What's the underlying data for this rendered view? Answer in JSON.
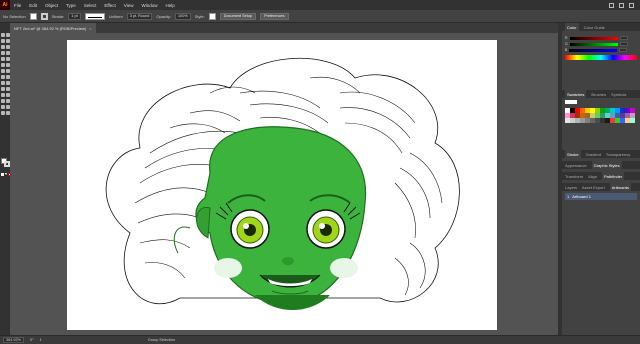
{
  "app": {
    "logo": "Ai"
  },
  "menu": [
    "File",
    "Edit",
    "Object",
    "Type",
    "Select",
    "Effect",
    "View",
    "Window",
    "Help"
  ],
  "control_bar": {
    "selection_label": "No Selection",
    "stroke_label": "Stroke:",
    "stroke_weight": "1 pt",
    "brush_label": "Uniform",
    "brush_style": "3 pt. Round",
    "opacity_label": "Opacity:",
    "opacity_value": "100%",
    "style_label": "Style:",
    "document_setup": "Document Setup",
    "preferences": "Preferences"
  },
  "document_tab": {
    "title": "NFT 2nd.ai* @ 384.92 % (RGB/Preview)",
    "close": "×"
  },
  "panels": {
    "color_tabs": [
      "Color",
      "Color Guide"
    ],
    "color_sliders": [
      {
        "label": "R",
        "gradient": "linear-gradient(90deg,#000,#f00)"
      },
      {
        "label": "G",
        "gradient": "linear-gradient(90deg,#000,#0f0)"
      },
      {
        "label": "B",
        "gradient": "linear-gradient(90deg,#000,#00f)"
      }
    ],
    "swatch_tabs": [
      "Swatches",
      "Brushes",
      "Symbols"
    ],
    "swatches": [
      "#ffffff",
      "#000000",
      "#ff0000",
      "#ff6600",
      "#ffcc00",
      "#ffff00",
      "#99cc00",
      "#00aa00",
      "#00aa66",
      "#00cccc",
      "#0099ff",
      "#0033cc",
      "#6600cc",
      "#cc00cc",
      "#ff99cc",
      "#cc3366",
      "#993300",
      "#cc6600",
      "#996633",
      "#cccc66",
      "#66cc66",
      "#339966",
      "#66cccc",
      "#6699cc",
      "#336699",
      "#663399",
      "#996699",
      "#cc99cc",
      "#e6e6e6",
      "#cccccc",
      "#b3b3b3",
      "#999999",
      "#808080",
      "#666666",
      "#4d4d4d",
      "#333333",
      "#1a1a1a",
      "#ff3333",
      "#33cc33",
      "#3366ff",
      "#ffcc99",
      "#99ffcc"
    ],
    "stroke_tabs": [
      "Stroke",
      "Gradient",
      "Transparency"
    ],
    "appearance_tabs": [
      "Appearance",
      "Graphic Styles"
    ],
    "transform_tabs": [
      "Transform",
      "Align",
      "Pathfinder"
    ],
    "layers_tabs": [
      "Layers",
      "Asset Export",
      "Artboards"
    ],
    "artboard_item": {
      "index": "1",
      "name": "Artboard 1"
    }
  },
  "status_bar": {
    "zoom": "384.92%",
    "angle": "0°",
    "artboard_nav": "1",
    "tool": "Group Selection"
  },
  "colors": {
    "skin": "#3cb33c",
    "skin_dark": "#1f7d1f",
    "eye_iris": "#9fd61c",
    "cheek": "#e8f6e8",
    "hair_line": "#111111"
  }
}
